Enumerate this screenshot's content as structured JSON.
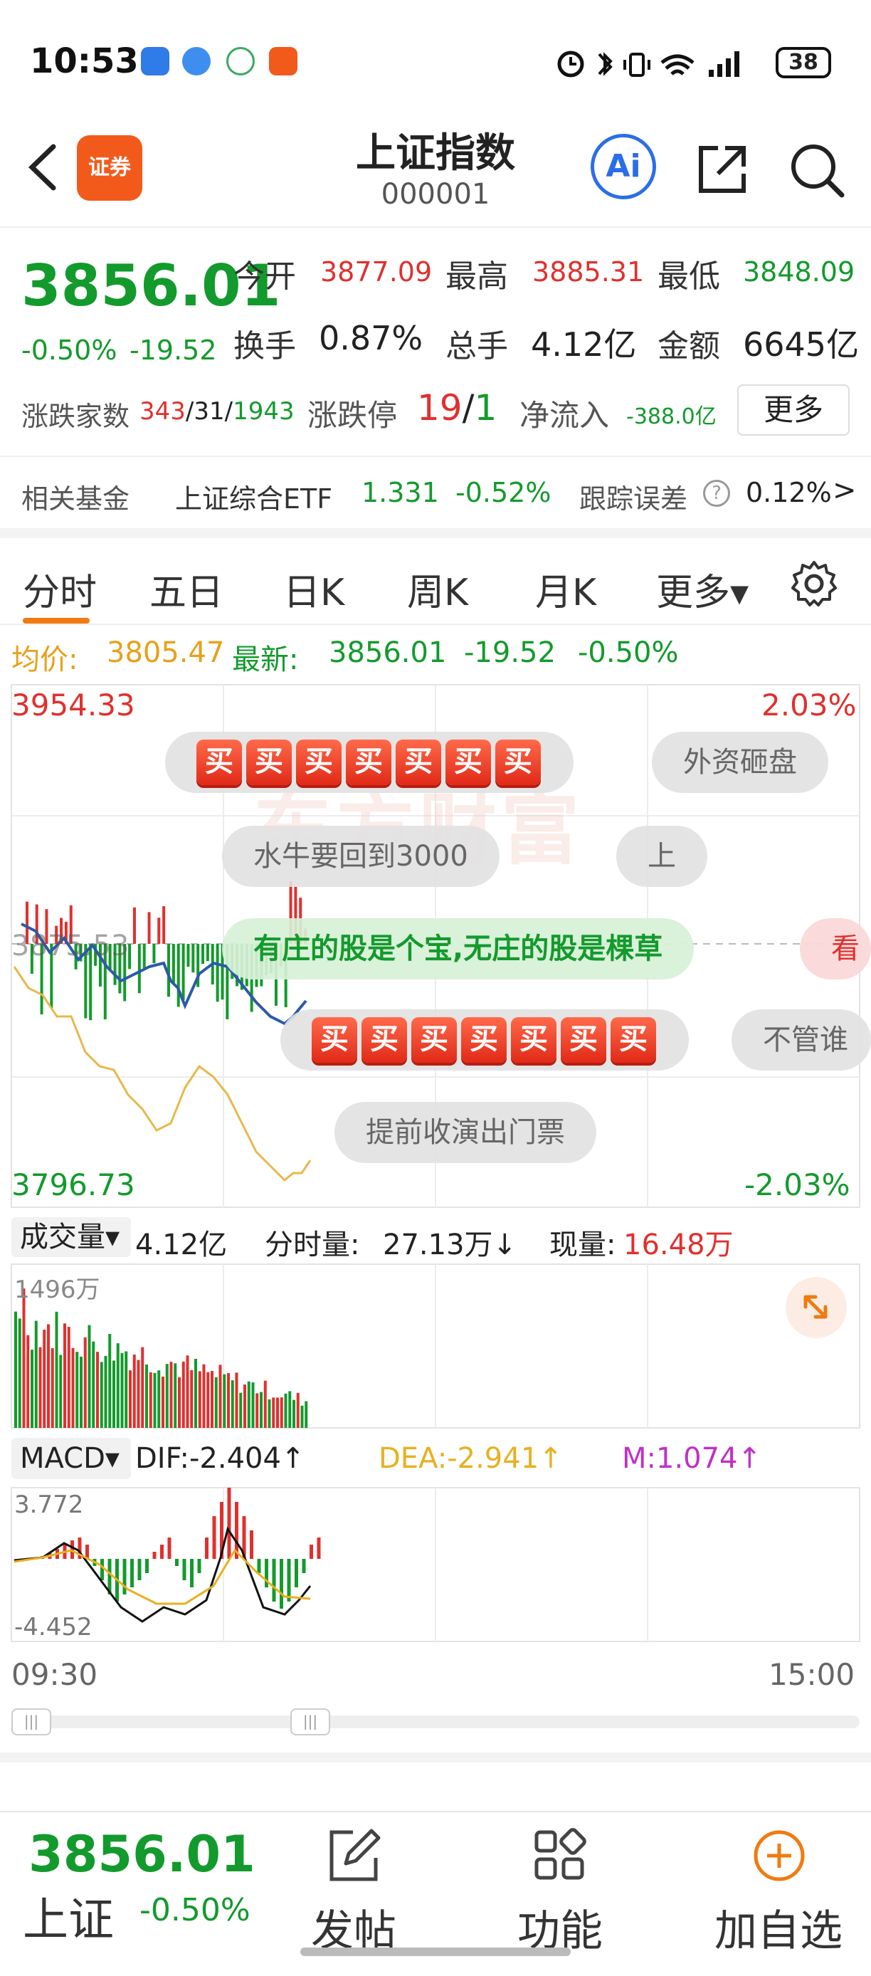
{
  "status_bar": {
    "time": "10:53",
    "battery": "38"
  },
  "header": {
    "title": "上证指数",
    "code": "000001",
    "logo_text": "证券",
    "ai_label": "Ai"
  },
  "quote": {
    "price": "3856.01",
    "change_pct": "-0.50%",
    "change_abs": "-19.52",
    "open_label": "今开",
    "open": "3877.09",
    "high_label": "最高",
    "high": "3885.31",
    "low_label": "最低",
    "low": "3848.09",
    "turnover_label": "换手",
    "turnover": "0.87%",
    "volume_label": "总手",
    "volume": "4.12亿",
    "amount_label": "金额",
    "amount": "6645亿",
    "breadth_label": "涨跌家数",
    "breadth_up": "343",
    "breadth_flat": "31",
    "breadth_down": "1943",
    "limit_label": "涨跌停",
    "limit_up": "19",
    "limit_down": "1",
    "netflow_label": "净流入",
    "netflow": "-388.0亿",
    "more_label": "更多"
  },
  "fund_row": {
    "label": "相关基金",
    "fund_name": "上证综合ETF",
    "fund_price": "1.331",
    "fund_change": "-0.52%",
    "tracking_label": "跟踪误差",
    "tracking_value": "0.12%",
    "help_icon": "?"
  },
  "tabs": [
    {
      "label": "分时",
      "active": true
    },
    {
      "label": "五日"
    },
    {
      "label": "日K"
    },
    {
      "label": "周K"
    },
    {
      "label": "月K"
    },
    {
      "label": "更多▾"
    }
  ],
  "avg_row": {
    "avg_label": "均价:",
    "avg_value": "3805.47",
    "latest_label": "最新:",
    "latest_value": "3856.01",
    "latest_change": "-19.52",
    "latest_pct": "-0.50%"
  },
  "intraday": {
    "y_max": "3954.33",
    "y_min": "3796.73",
    "pct_max": "2.03%",
    "pct_min": "-2.03%",
    "prev_close_label": "3875.53",
    "watermark": "东方财富"
  },
  "bubbles": {
    "buy_char": "买",
    "b1": "外资砸盘",
    "b2": "水牛要回到3000",
    "b3": "上",
    "b4": "有庄的股是个宝,无庄的股是棵草",
    "b5": "看",
    "b6": "不管谁",
    "b7": "提前收演出门票"
  },
  "volume_row": {
    "label": "成交量▾",
    "total": "4.12亿",
    "tick_label": "分时量:",
    "tick_value": "27.13万↓",
    "now_label": "现量:",
    "now_value": "16.48万",
    "y_max": "1496万"
  },
  "macd_row": {
    "label": "MACD▾",
    "dif": "DIF:-2.404↑",
    "dea": "DEA:-2.941↑",
    "m": "M:1.074↑",
    "y_max": "3.772",
    "y_min": "-4.452"
  },
  "time_axis": {
    "start": "09:30",
    "end": "15:00"
  },
  "bottom": {
    "price": "3856.01",
    "name": "上证",
    "change": "-0.50%",
    "nav_post": "发帖",
    "nav_func": "功能",
    "nav_watch": "加自选"
  },
  "colors": {
    "up": "#e0302e",
    "down": "#139a2c",
    "accent": "#f07b10",
    "price_line": "#2c5aa8",
    "avg_line": "#e8b84a"
  }
}
